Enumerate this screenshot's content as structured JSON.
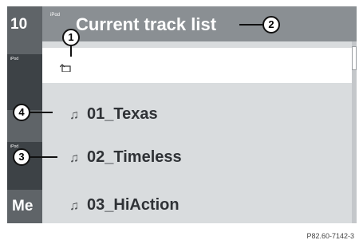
{
  "clock_text": "10",
  "left_tag1": "iPod",
  "left_tag2": "iPod",
  "menu_partial": "Me",
  "header": {
    "tag": "iPod",
    "title": "Current track list"
  },
  "tracks": [
    {
      "label": "01_Texas"
    },
    {
      "label": "02_Timeless"
    },
    {
      "label": "03_HiAction"
    }
  ],
  "callouts": {
    "c1": "1",
    "c2": "2",
    "c3": "3",
    "c4": "4"
  },
  "note_glyph": "♫",
  "caption": "P82.60-7142-3"
}
